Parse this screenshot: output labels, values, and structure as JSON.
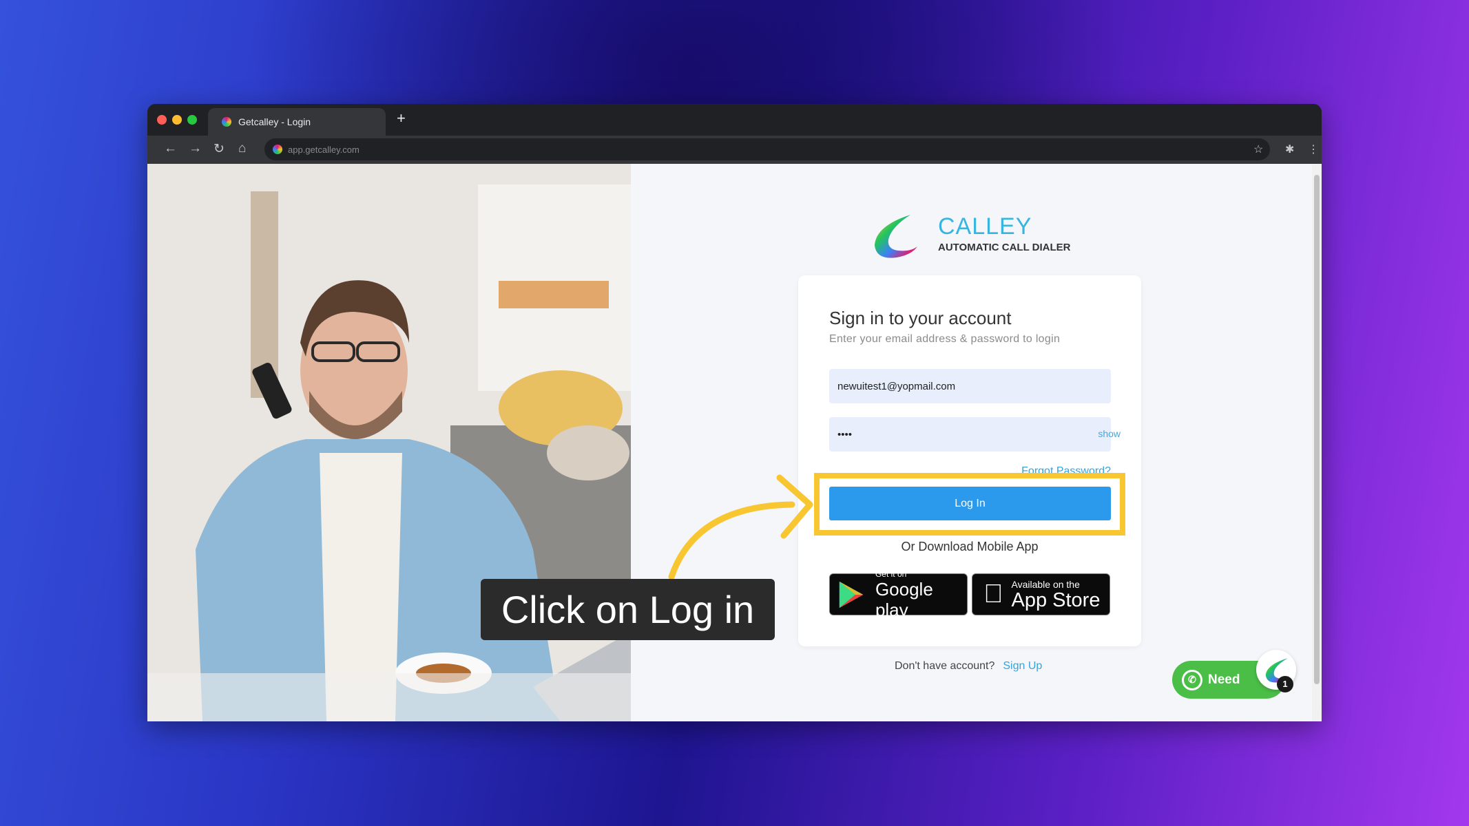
{
  "browser": {
    "tab_title": "Getcalley - Login",
    "new_tab": "+",
    "url": "app.getcalley.com"
  },
  "brand": {
    "name": "CALLEY",
    "tagline": "AUTOMATIC CALL DIALER"
  },
  "login": {
    "title": "Sign in to your account",
    "subtitle": "Enter your email address & password to login",
    "email_value": "newuitest1@yopmail.com",
    "password_value": "••••",
    "show_label": "show",
    "forgot_label": "Forgot Password?",
    "login_label": "Log In",
    "download_label": "Or Download Mobile App",
    "google": {
      "small": "Get it on",
      "big": "Google play"
    },
    "apple": {
      "small": "Available on the",
      "big": "App Store"
    },
    "no_account": "Don't have account?",
    "signup_label": "Sign Up"
  },
  "whatsapp": {
    "label": "Need",
    "badge": "1"
  },
  "annotation": {
    "caption": "Click on Log in",
    "highlight_color": "#f7c630"
  },
  "colors": {
    "accent": "#2b9aec",
    "whatsapp": "#4bbe48"
  }
}
